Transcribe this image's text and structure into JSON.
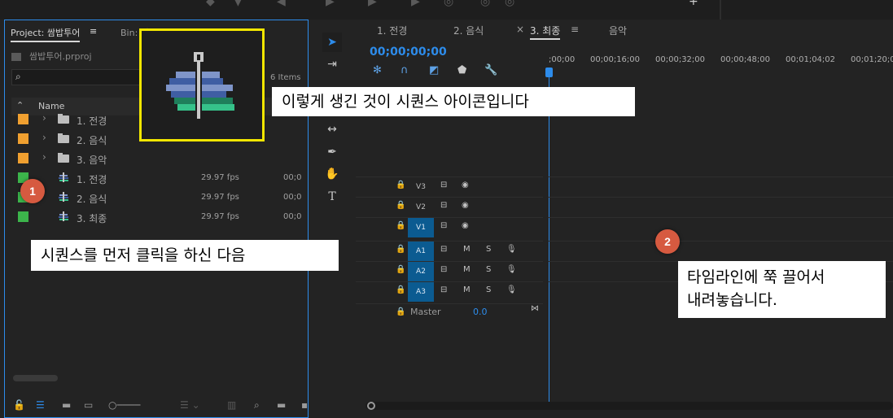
{
  "project_panel": {
    "tab_label": "Project: 쌈밥투어",
    "bin_label": "Bin: 최종",
    "project_file": "쌈밥투어.prproj",
    "items_count": "6 Items",
    "name_header": "Name",
    "rows": [
      {
        "name": "1. 전경",
        "kind": "bin",
        "color": "#f0a030",
        "fps": "",
        "tc": ""
      },
      {
        "name": "2. 음식",
        "kind": "bin",
        "color": "#f0a030",
        "fps": "",
        "tc": ""
      },
      {
        "name": "3. 음악",
        "kind": "bin",
        "color": "#f0a030",
        "fps": "",
        "tc": ""
      },
      {
        "name": "1. 전경",
        "kind": "sequence",
        "color": "#3cb44b",
        "fps": "29.97 fps",
        "tc": "00;0"
      },
      {
        "name": "2. 음식",
        "kind": "sequence",
        "color": "#3cb44b",
        "fps": "29.97 fps",
        "tc": "00;0"
      },
      {
        "name": "3. 최종",
        "kind": "sequence",
        "color": "#3cb44b",
        "fps": "29.97 fps",
        "tc": "00;0"
      }
    ]
  },
  "timeline_panel": {
    "tabs": [
      "1. 전경",
      "2. 음식",
      "3. 최종",
      "음악"
    ],
    "timecode": "00;00;00;00",
    "ruler_ticks": [
      ";00;00",
      "00;00;16;00",
      "00;00;32;00",
      "00;00;48;00",
      "00;01;04;02",
      "00;01;20;0"
    ],
    "tracks": [
      {
        "name": "V3",
        "type": "video"
      },
      {
        "name": "V2",
        "type": "video"
      },
      {
        "name": "V1",
        "type": "video"
      },
      {
        "name": "A1",
        "type": "audio"
      },
      {
        "name": "A2",
        "type": "audio"
      },
      {
        "name": "A3",
        "type": "audio"
      }
    ],
    "master_label": "Master",
    "master_value": "0.0"
  },
  "annotations": {
    "icon_caption": "이렇게 생긴 것이 시퀀스 아이콘입니다",
    "step1_caption": "시퀀스를 먼저 클릭을 하신 다음",
    "step2_caption_line1": "타임라인에 쭉 끌어서",
    "step2_caption_line2": "내려놓습니다.",
    "badge1": "1",
    "badge2": "2"
  },
  "colors": {
    "accent": "#2d8ceb",
    "highlight_box": "#f2e600",
    "badge": "#d65a40",
    "selected_track": "#0b5b91"
  }
}
